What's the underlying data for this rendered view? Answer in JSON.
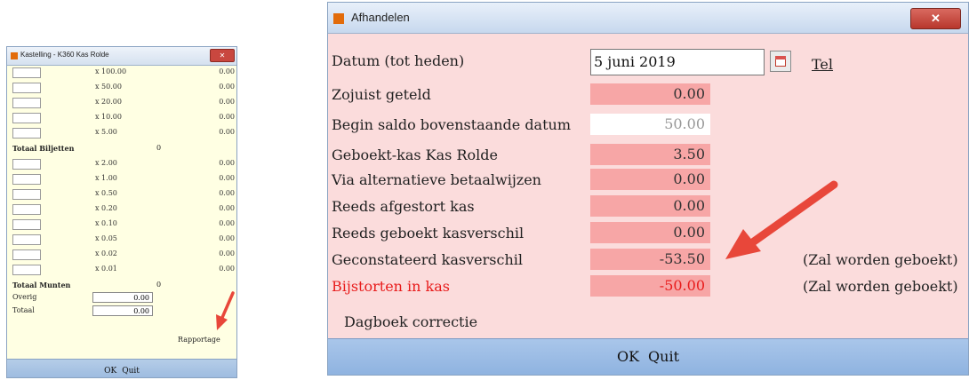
{
  "small_window": {
    "title": "Kastelling - K360 Kas Rolde",
    "close_glyph": "✕",
    "bills": [
      {
        "label": "x 100.00",
        "value": "0.00"
      },
      {
        "label": "x 50.00",
        "value": "0.00"
      },
      {
        "label": "x 20.00",
        "value": "0.00"
      },
      {
        "label": "x 10.00",
        "value": "0.00"
      },
      {
        "label": "x 5.00",
        "value": "0.00"
      }
    ],
    "bills_total": {
      "label": "Totaal Biljetten",
      "value": "0"
    },
    "coins": [
      {
        "label": "x 2.00",
        "value": "0.00"
      },
      {
        "label": "x 1.00",
        "value": "0.00"
      },
      {
        "label": "x 0.50",
        "value": "0.00"
      },
      {
        "label": "x 0.20",
        "value": "0.00"
      },
      {
        "label": "x 0.10",
        "value": "0.00"
      },
      {
        "label": "x 0.05",
        "value": "0.00"
      },
      {
        "label": "x 0.02",
        "value": "0.00"
      },
      {
        "label": "x 0.01",
        "value": "0.00"
      }
    ],
    "coins_total": {
      "label": "Totaal Munten",
      "value": "0"
    },
    "overig": {
      "label": "Overig",
      "value": "0.00"
    },
    "totaal": {
      "label": "Totaal",
      "value": "0.00"
    },
    "rapportage": "Rapportage",
    "ok_label": "OK",
    "quit_label": "Quit"
  },
  "large_window": {
    "title": "Afhandelen",
    "close_glyph": "✕",
    "datum_label": "Datum (tot heden)",
    "datum_value": "5 juni 2019",
    "tel_label": "Tel",
    "rows": [
      {
        "label": "Zojuist geteld",
        "value": "0.00",
        "note": ""
      },
      {
        "label": "Begin saldo bovenstaande datum",
        "value": "50.00",
        "note": ""
      },
      {
        "label": "Geboekt-kas Kas Rolde",
        "value": "3.50",
        "note": ""
      },
      {
        "label": "Via alternatieve betaalwijzen",
        "value": "0.00",
        "note": ""
      },
      {
        "label": "Reeds afgestort kas",
        "value": "0.00",
        "note": ""
      },
      {
        "label": "Reeds geboekt kasverschil",
        "value": "0.00",
        "note": ""
      },
      {
        "label": "Geconstateerd kasverschil",
        "value": "-53.50",
        "note": "(Zal worden geboekt)"
      },
      {
        "label": "Bijstorten in kas",
        "value": "-50.00",
        "note": "(Zal worden geboekt)"
      }
    ],
    "dagboek_label": "Dagboek correctie",
    "ok_label": "OK",
    "quit_label": "Quit"
  },
  "colors": {
    "small_bg": "#ffffe3",
    "large_bg": "#fbdcdc",
    "value_field": "#f7a6a6",
    "alert_red": "#e81c1c",
    "arrow": "#e8473a",
    "button_bar": "#9ebce0"
  }
}
